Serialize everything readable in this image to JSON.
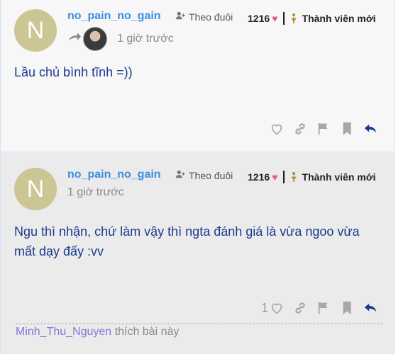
{
  "posts": [
    {
      "avatar_letter": "N",
      "username": "no_pain_no_gain",
      "follow_label": "Theo đuôi",
      "score": "1216",
      "badge": "Thành viên mới",
      "time": "1 giờ trước",
      "content": "Lầu chủ bình tĩnh =))",
      "reply_to": true
    },
    {
      "avatar_letter": "N",
      "username": "no_pain_no_gain",
      "follow_label": "Theo đuôi",
      "score": "1216",
      "badge": "Thành viên mới",
      "time": "1 giờ trước",
      "content": "Ngu thì nhận, chứ làm vậy thì ngta đánh giá là vừa ngoo vừa mất dạy đấy :vv",
      "like_count": "1",
      "liked_by_user": "Minh_Thu_Nguyen",
      "liked_by_text": " thích bài này"
    }
  ],
  "icons": [
    "heart-icon",
    "link-icon",
    "flag-icon",
    "bookmark-icon",
    "reply-icon",
    "add-user-icon",
    "reply-arrow-icon",
    "badge-icon"
  ],
  "colors": {
    "username": "#3a8fe0",
    "content": "#1a3a8f",
    "heart": "#e85b82",
    "badge": "#b8862b",
    "reply": "#1a3a8f",
    "liked_by": "#8a74d9"
  }
}
